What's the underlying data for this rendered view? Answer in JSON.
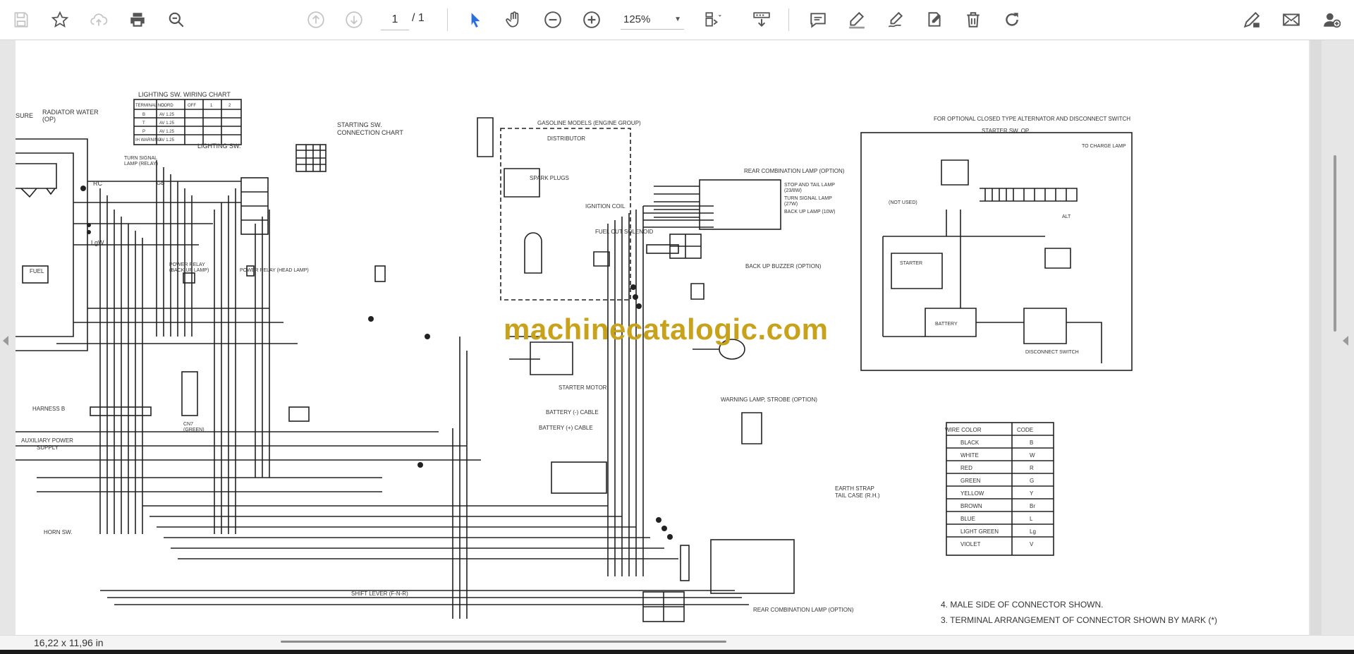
{
  "toolbar": {
    "accent_color": "#2a6fdb",
    "buttons": [
      {
        "name": "save-icon"
      },
      {
        "name": "star-icon"
      },
      {
        "name": "cloud-upload-icon"
      },
      {
        "name": "print-icon"
      },
      {
        "name": "zoom-search-icon"
      },
      {
        "name": "page-up-icon"
      },
      {
        "name": "page-down-icon"
      },
      {
        "name": "select-cursor-icon"
      },
      {
        "name": "hand-icon"
      },
      {
        "name": "zoom-out-icon"
      },
      {
        "name": "zoom-in-icon"
      },
      {
        "name": "fit-page-icon"
      },
      {
        "name": "scroll-mode-icon"
      },
      {
        "name": "comment-icon"
      },
      {
        "name": "highlight-pen-icon"
      },
      {
        "name": "draw-icon"
      },
      {
        "name": "stamp-icon"
      },
      {
        "name": "trash-icon"
      },
      {
        "name": "rotate-icon"
      },
      {
        "name": "edit-link-icon"
      },
      {
        "name": "mail-icon"
      },
      {
        "name": "add-user-icon"
      }
    ],
    "page_current": "1",
    "page_total": "/ 1",
    "zoom_value": "125%"
  },
  "document": {
    "watermark": "machinecatalogic.com",
    "labels": {
      "lighting_chart_title": "LIGHTING SW. WIRING CHART",
      "lighting_chart_cols": [
        "TERMINAL NO.",
        "CORD",
        "OFF",
        "1",
        "2"
      ],
      "lighting_chart_rows": [
        [
          "B",
          "AV 1.25"
        ],
        [
          "T",
          "AV 1.25"
        ],
        [
          "P",
          "AV 1.25"
        ],
        [
          "IH WARNING",
          "AV 1.25"
        ]
      ],
      "sure": "SURE",
      "radiator": "RADIATOR WATER",
      "radiator_op": "(OP)",
      "starting_sw": "STARTING SW.",
      "connection_chart": "CONNECTION CHART",
      "lighting_sw": "LIGHTING SW.",
      "turn_signal": "TURN SIGNAL",
      "lamp_relay": "LAMP (RELAY)",
      "rc": "RC",
      "lgw": "LgW",
      "gb": "GB",
      "fuel": "FUEL",
      "power_relay_back": "POWER RELAY",
      "power_relay_back2": "(BACK UP LAMP)",
      "power_relay_head": "POWER RELAY (HEAD LAMP)",
      "gasoline_models": "GASOLINE MODELS (ENGINE GROUP)",
      "distributor": "DISTRIBUTOR",
      "spark_plugs": "SPARK PLUGS",
      "ignition_coil": "IGNITION COIL",
      "fuel_cut": "FUEL CUT SOLENOID",
      "rear_combo_top": "REAR COMBINATION LAMP (OPTION)",
      "stop_tail": "STOP AND TAIL LAMP",
      "stop_tail_w": "(23/8W)",
      "turn_lamp": "TURN SIGNAL LAMP",
      "turn_lamp_w": "(27W)",
      "backup_lamp": "BACK UP LAMP (10W)",
      "backup_buzzer": "BACK UP BUZZER (OPTION)",
      "starter_motor": "STARTER MOTOR",
      "battery_cable_minus": "BATTERY (-) CABLE",
      "battery_cable_plus": "BATTERY (+) CABLE",
      "warning_lamp": "WARNING LAMP, STROBE (OPTION)",
      "earth_strap": "EARTH STRAP",
      "tail_case": "TAIL CASE (R.H.)",
      "harness_b": "HARNESS B",
      "auxiliary": "AUXILIARY POWER",
      "supply": "SUPPLY",
      "cn7": "CN7",
      "green_note": "(GREEN)",
      "horn_sw": "HORN SW.",
      "shift_lever": "SHIFT LEVER (F-N-R)",
      "rear_combo_bottom": "REAR COMBINATION LAMP (OPTION)",
      "optional_title": "FOR OPTIONAL CLOSED TYPE ALTERNATOR AND DISCONNECT SWITCH",
      "starter_sw": "STARTER SW. OP",
      "to_charge": "TO CHARGE LAMP",
      "not_used": "(NOT USED)",
      "alt": "ALT",
      "starter": "STARTER",
      "battery": "BATTERY",
      "disconnect": "DISCONNECT SWITCH",
      "note4": "4. MALE SIDE OF CONNECTOR SHOWN.",
      "note3": "3. TERMINAL ARRANGEMENT OF CONNECTOR SHOWN BY MARK (*)",
      "color_table_head": [
        "WIRE COLOR",
        "CODE"
      ],
      "color_table_rows": [
        [
          "BLACK",
          "B"
        ],
        [
          "WHITE",
          "W"
        ],
        [
          "RED",
          "R"
        ],
        [
          "GREEN",
          "G"
        ],
        [
          "YELLOW",
          "Y"
        ],
        [
          "BROWN",
          "Br"
        ],
        [
          "BLUE",
          "L"
        ],
        [
          "LIGHT GREEN",
          "Lg"
        ],
        [
          "VIOLET",
          "V"
        ]
      ]
    }
  },
  "status": {
    "page_size": "16,22 x 11,96 in"
  }
}
